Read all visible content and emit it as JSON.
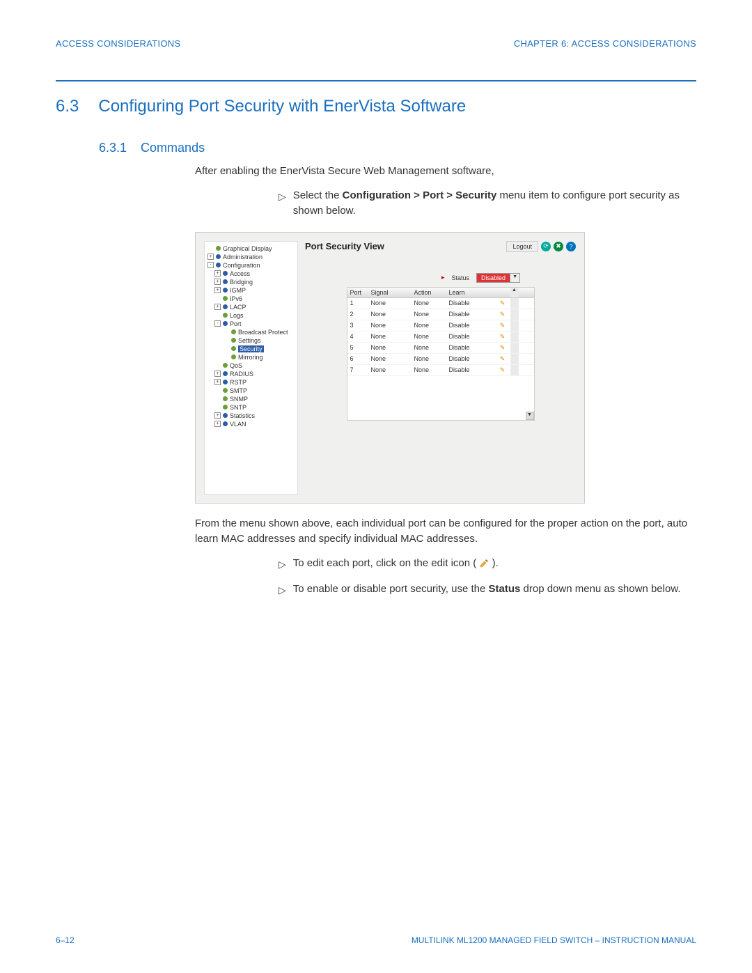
{
  "header": {
    "left": "ACCESS CONSIDERATIONS",
    "right": "CHAPTER 6: ACCESS CONSIDERATIONS"
  },
  "section": {
    "num": "6.3",
    "title": "Configuring Port Security with EnerVista Software"
  },
  "subsection": {
    "num": "6.3.1",
    "title": "Commands"
  },
  "p1": "After enabling the EnerVista Secure Web Management software,",
  "step1_a": "Select the ",
  "step1_b": "Configuration > Port > Security",
  "step1_c": " menu item to configure port security as shown below.",
  "p2": "From the menu shown above, each individual port can be configured for the proper action on the port, auto learn MAC addresses and specify individual MAC addresses.",
  "step2": "To edit each port, click on the edit icon (",
  "step2_end": ").",
  "step3_a": "To enable or disable port security, use the ",
  "step3_b": "Status",
  "step3_c": " drop down menu as shown below.",
  "footer": {
    "left": "6–12",
    "right": "MULTILINK ML1200 MANAGED FIELD SWITCH – INSTRUCTION MANUAL"
  },
  "app": {
    "title": "Port Security View",
    "logout": "Logout",
    "status_label": "Status",
    "status_value": "Disabled",
    "tree": [
      {
        "exp": "",
        "ind": 0,
        "bullet": "green",
        "label": "Graphical Display"
      },
      {
        "exp": "+",
        "ind": 0,
        "bullet": "blue",
        "label": "Administration"
      },
      {
        "exp": "-",
        "ind": 0,
        "bullet": "blue",
        "label": "Configuration"
      },
      {
        "exp": "+",
        "ind": 1,
        "bullet": "blue",
        "label": "Access"
      },
      {
        "exp": "+",
        "ind": 1,
        "bullet": "blue",
        "label": "Bridging"
      },
      {
        "exp": "+",
        "ind": 1,
        "bullet": "blue",
        "label": "IGMP"
      },
      {
        "exp": "",
        "ind": 1,
        "bullet": "green",
        "label": "IPv6"
      },
      {
        "exp": "+",
        "ind": 1,
        "bullet": "blue",
        "label": "LACP"
      },
      {
        "exp": "",
        "ind": 1,
        "bullet": "green",
        "label": "Logs"
      },
      {
        "exp": "-",
        "ind": 1,
        "bullet": "blue",
        "label": "Port"
      },
      {
        "exp": "",
        "ind": 2,
        "bullet": "green",
        "label": "Broadcast Protect"
      },
      {
        "exp": "",
        "ind": 2,
        "bullet": "green",
        "label": "Settings"
      },
      {
        "exp": "",
        "ind": 2,
        "bullet": "green",
        "label": "Security",
        "selected": true
      },
      {
        "exp": "",
        "ind": 2,
        "bullet": "green",
        "label": "Mirroring"
      },
      {
        "exp": "",
        "ind": 1,
        "bullet": "green",
        "label": "QoS"
      },
      {
        "exp": "+",
        "ind": 1,
        "bullet": "blue",
        "label": "RADIUS"
      },
      {
        "exp": "+",
        "ind": 1,
        "bullet": "blue",
        "label": "RSTP"
      },
      {
        "exp": "",
        "ind": 1,
        "bullet": "green",
        "label": "SMTP"
      },
      {
        "exp": "",
        "ind": 1,
        "bullet": "green",
        "label": "SNMP"
      },
      {
        "exp": "",
        "ind": 1,
        "bullet": "green",
        "label": "SNTP"
      },
      {
        "exp": "+",
        "ind": 1,
        "bullet": "blue",
        "label": "Statistics"
      },
      {
        "exp": "+",
        "ind": 1,
        "bullet": "blue",
        "label": "VLAN"
      }
    ],
    "columns": {
      "port": "Port",
      "signal": "Signal",
      "action": "Action",
      "learn": "Learn"
    },
    "rows": [
      {
        "port": "1",
        "signal": "None",
        "action": "None",
        "learn": "Disable"
      },
      {
        "port": "2",
        "signal": "None",
        "action": "None",
        "learn": "Disable"
      },
      {
        "port": "3",
        "signal": "None",
        "action": "None",
        "learn": "Disable"
      },
      {
        "port": "4",
        "signal": "None",
        "action": "None",
        "learn": "Disable"
      },
      {
        "port": "5",
        "signal": "None",
        "action": "None",
        "learn": "Disable"
      },
      {
        "port": "6",
        "signal": "None",
        "action": "None",
        "learn": "Disable"
      },
      {
        "port": "7",
        "signal": "None",
        "action": "None",
        "learn": "Disable"
      }
    ]
  }
}
